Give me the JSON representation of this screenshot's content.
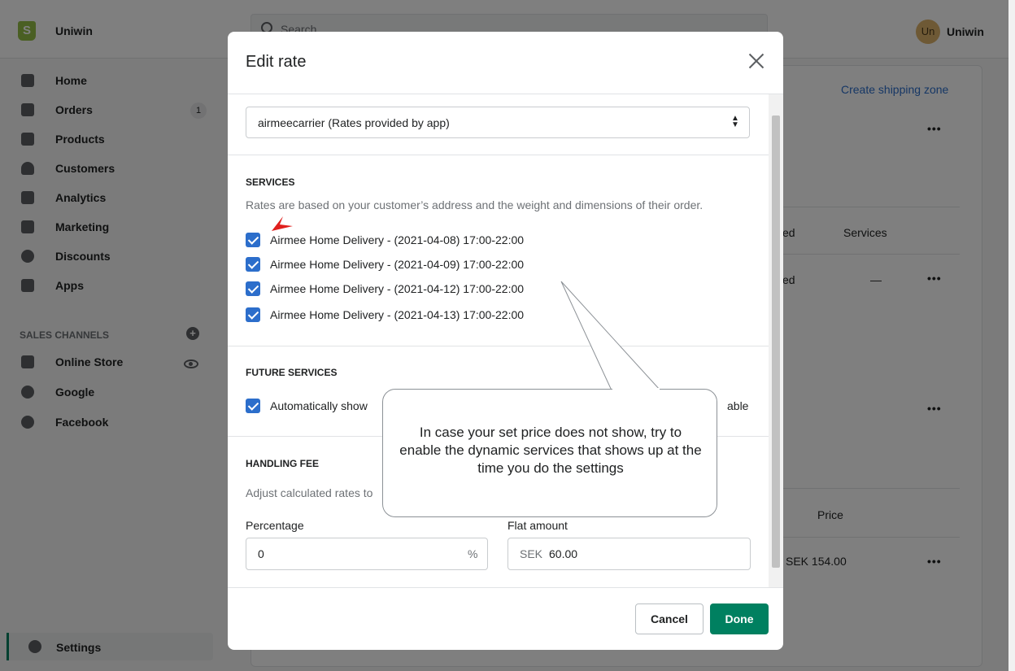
{
  "topbar": {
    "store_name": "Uniwin",
    "search_placeholder": "Search",
    "avatar_initials": "Un",
    "user_name": "Uniwin"
  },
  "sidebar": {
    "items": [
      {
        "label": "Home",
        "icon": "home-icon"
      },
      {
        "label": "Orders",
        "icon": "orders-icon",
        "badge": "1"
      },
      {
        "label": "Products",
        "icon": "tag-icon"
      },
      {
        "label": "Customers",
        "icon": "person-icon"
      },
      {
        "label": "Analytics",
        "icon": "bar-chart-icon"
      },
      {
        "label": "Marketing",
        "icon": "megaphone-icon"
      },
      {
        "label": "Discounts",
        "icon": "discount-icon"
      },
      {
        "label": "Apps",
        "icon": "apps-icon"
      }
    ],
    "sales_channels_heading": "SALES CHANNELS",
    "channels": [
      {
        "label": "Online Store",
        "icon": "store-icon"
      },
      {
        "label": "Google",
        "icon": "google-icon"
      },
      {
        "label": "Facebook",
        "icon": "facebook-icon"
      }
    ],
    "settings_label": "Settings"
  },
  "background": {
    "create_zone_link": "Create shipping zone",
    "col_partial_1": "ed",
    "col_services": "Services",
    "row_partial": "ed",
    "row_dash": "—",
    "col_price": "Price",
    "row_price": "SEK 154.00"
  },
  "modal": {
    "title": "Edit rate",
    "carrier_select_value": "airmeecarrier (Rates provided by app)",
    "services_title": "SERVICES",
    "services_desc": "Rates are based on your customer’s address and the weight and dimensions of their order.",
    "services": [
      {
        "label": "Airmee Home Delivery - (2021-04-08) 17:00-22:00",
        "checked": true
      },
      {
        "label": "Airmee Home Delivery - (2021-04-09) 17:00-22:00",
        "checked": true
      },
      {
        "label": "Airmee Home Delivery - (2021-04-12) 17:00-22:00",
        "checked": true
      },
      {
        "label": "Airmee Home Delivery - (2021-04-13) 17:00-22:00",
        "checked": true
      }
    ],
    "future_title": "FUTURE SERVICES",
    "future_label_start": "Automatically show",
    "future_label_end": "able",
    "handling_title": "HANDLING FEE",
    "handling_desc": "Adjust calculated rates to",
    "percentage_label": "Percentage",
    "percentage_value": "0",
    "percentage_suffix": "%",
    "flat_label": "Flat amount",
    "flat_prefix": "SEK",
    "flat_value": "60.00",
    "cancel_label": "Cancel",
    "done_label": "Done"
  },
  "callout": {
    "text": "In case your set price does not show, try to enable the dynamic services that shows up at the time you do the settings"
  },
  "colors": {
    "primary": "#008060",
    "checkbox": "#2c6ecb",
    "link": "#2c6ecb",
    "annotation_arrow": "#e0201e"
  }
}
